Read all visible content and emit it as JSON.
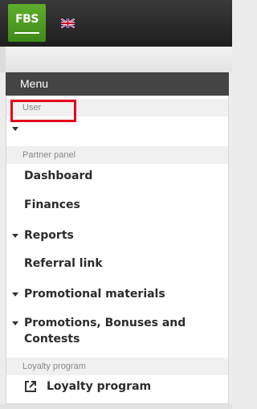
{
  "header": {
    "logo_text": "FBS",
    "language_icon": "uk-flag-icon"
  },
  "menu": {
    "title": "Menu",
    "sections": {
      "user": "User",
      "partner": "Partner panel",
      "loyalty": "Loyalty program"
    },
    "items": {
      "user_dropdown": "",
      "dashboard": "Dashboard",
      "finances": "Finances",
      "reports": "Reports",
      "referral": "Referral link",
      "promo_materials": "Promotional materials",
      "promotions_line1": "Promotions, Bonuses and",
      "promotions_line2": "Contests",
      "loyalty_program": "Loyalty program"
    },
    "icons": {
      "collapse": "caret-down-icon",
      "external": "external-link-icon"
    }
  },
  "colors": {
    "topbar": "#2a2a2a",
    "logo_green": "#4f9b22",
    "menu_header": "#444444",
    "highlight_red": "#e5001b"
  }
}
